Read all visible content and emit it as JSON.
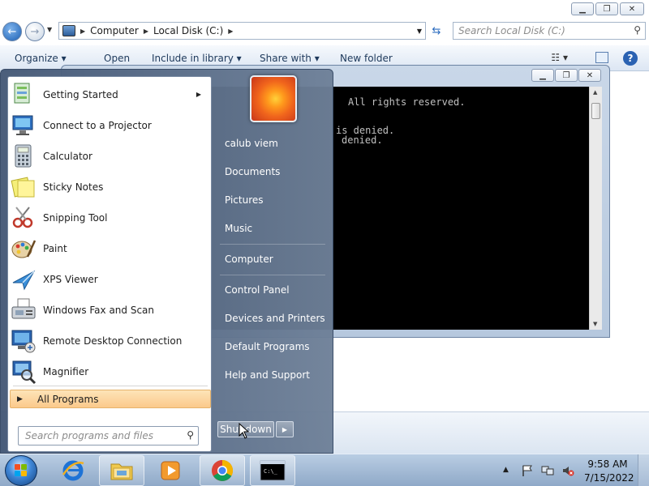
{
  "explorer": {
    "address": {
      "root": "Computer",
      "location": "Local Disk (C:)"
    },
    "search_placeholder": "Search Local Disk (C:)",
    "toolbar": {
      "organize": "Organize ▾",
      "open": "Open",
      "include": "Include in library ▾",
      "share": "Share with ▾",
      "new_folder": "New folder"
    }
  },
  "cmd": {
    "lines": [
      "All rights reserved.",
      "is denied.",
      "denied."
    ]
  },
  "start_menu": {
    "programs": [
      {
        "label": "Getting Started",
        "icon": "getting-started-icon",
        "has_submenu": true
      },
      {
        "label": "Connect to a Projector",
        "icon": "projector-icon"
      },
      {
        "label": "Calculator",
        "icon": "calculator-icon"
      },
      {
        "label": "Sticky Notes",
        "icon": "sticky-notes-icon"
      },
      {
        "label": "Snipping Tool",
        "icon": "scissors-icon"
      },
      {
        "label": "Paint",
        "icon": "paint-palette-icon"
      },
      {
        "label": "XPS Viewer",
        "icon": "xps-viewer-icon"
      },
      {
        "label": "Windows Fax and Scan",
        "icon": "fax-icon"
      },
      {
        "label": "Remote Desktop Connection",
        "icon": "remote-desktop-icon"
      },
      {
        "label": "Magnifier",
        "icon": "magnifier-icon"
      }
    ],
    "all_programs": "All Programs",
    "search_placeholder": "Search programs and files",
    "right_links": [
      "calub viem",
      "Documents",
      "Pictures",
      "Music",
      "Computer",
      "Control Panel",
      "Devices and Printers",
      "Default Programs",
      "Help and Support"
    ],
    "shutdown": "Shut down"
  },
  "taskbar": {
    "apps": [
      "internet-explorer-icon",
      "windows-explorer-icon",
      "media-player-icon",
      "chrome-icon",
      "command-prompt-icon"
    ],
    "time": "9:58 AM",
    "date": "7/15/2022"
  },
  "colors": {
    "start_menu_blue": "#4a5f7e",
    "all_programs_highlight": "#fbc98b",
    "console_bg": "#000000",
    "console_text": "#c0c0c0"
  }
}
